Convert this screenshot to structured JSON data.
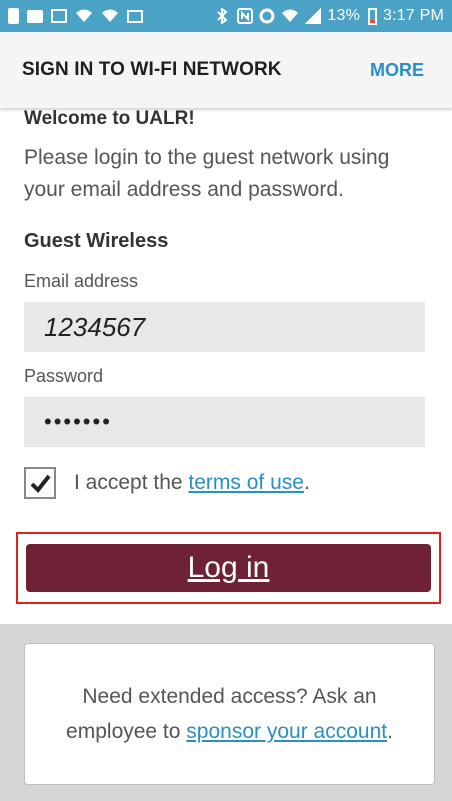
{
  "status_bar": {
    "left_icons": [
      "sim-icon",
      "chat-icon",
      "gallery-icon",
      "wifi-icon",
      "wifi-icon",
      "mail-icon"
    ],
    "right_icons": [
      "bluetooth-icon",
      "nfc-icon",
      "sync-icon",
      "wifi-calling-icon",
      "signal-icon"
    ],
    "battery_text": "13%",
    "time": "3:17 PM",
    "colors": {
      "background": "#4aa3c7"
    }
  },
  "app_bar": {
    "title": "SIGN IN TO WI-FI NETWORK",
    "more_label": "MORE",
    "colors": {
      "more": "#2a8fc2"
    }
  },
  "content": {
    "welcome": "Welcome to UALR!",
    "intro": "Please login to the guest network using your email address and password.",
    "section_title": "Guest Wireless",
    "email_label": "Email address",
    "email_value": "1234567",
    "password_label": "Password",
    "password_value": "•••••••",
    "accept_prefix": "I accept the ",
    "accept_link": "terms of use",
    "accept_suffix": ".",
    "accept_checked": true
  },
  "login": {
    "label": "Log in",
    "colors": {
      "background": "#6f2236",
      "highlight_border": "#e02020"
    }
  },
  "footer": {
    "text_prefix": "Need extended access? Ask an employee to ",
    "link": "sponsor your account",
    "text_suffix": "."
  }
}
